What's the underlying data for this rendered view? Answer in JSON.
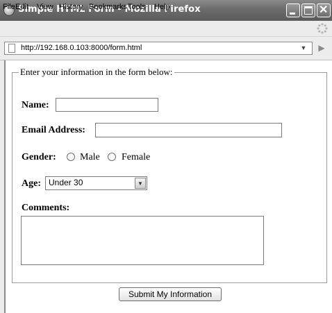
{
  "window": {
    "title": "Simple HTML Form - Mozilla Firefox"
  },
  "menu": [
    "File",
    "Edit",
    "View",
    "History",
    "Bookmarks",
    "Tools",
    "Help"
  ],
  "address": {
    "url": "http://192.168.0.103:8000/form.html"
  },
  "form": {
    "legend": "Enter your information in the form below:",
    "name_label": "Name:",
    "email_label": "Email Address:",
    "gender_label": "Gender:",
    "gender_options": [
      "Male",
      "Female"
    ],
    "age_label": "Age:",
    "age_selected": "Under 30",
    "comments_label": "Comments:",
    "submit_label": "Submit My Information"
  }
}
